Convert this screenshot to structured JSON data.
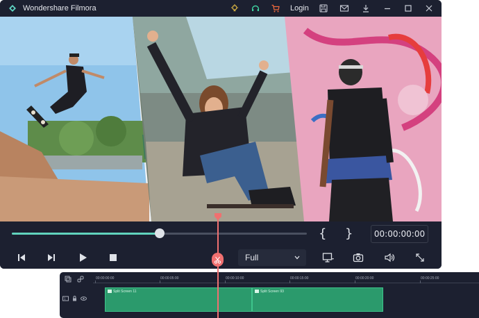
{
  "app": {
    "title": "Wondershare Filmora"
  },
  "titlebar": {
    "login_label": "Login",
    "icons": [
      "bulb-icon",
      "headset-icon",
      "cart-icon",
      "save-icon",
      "mail-icon",
      "download-icon",
      "minimize-icon",
      "maximize-icon",
      "close-icon"
    ]
  },
  "player": {
    "progress_fraction": 0.5,
    "in_mark": "{",
    "out_mark": "}",
    "timecode": "00:00:00:00",
    "quality_label": "Full",
    "buttons": [
      "step-back-button",
      "step-forward-button",
      "play-button",
      "stop-button",
      "display-button",
      "snapshot-button",
      "volume-button",
      "fullscreen-button"
    ]
  },
  "timeline": {
    "ruler": [
      "00:00:00:00",
      "00:00:05:00",
      "00:00:10:00",
      "00:00:15:00",
      "00:00:20:00",
      "00:00:25:00"
    ],
    "clips": [
      {
        "label": "Split Screen 11"
      },
      {
        "label": "Split Screen 93"
      }
    ]
  },
  "colors": {
    "window_bg": "#1c2030",
    "accent": "#61d3bd",
    "clip": "#2b9a6c",
    "playhead": "#f07070"
  }
}
